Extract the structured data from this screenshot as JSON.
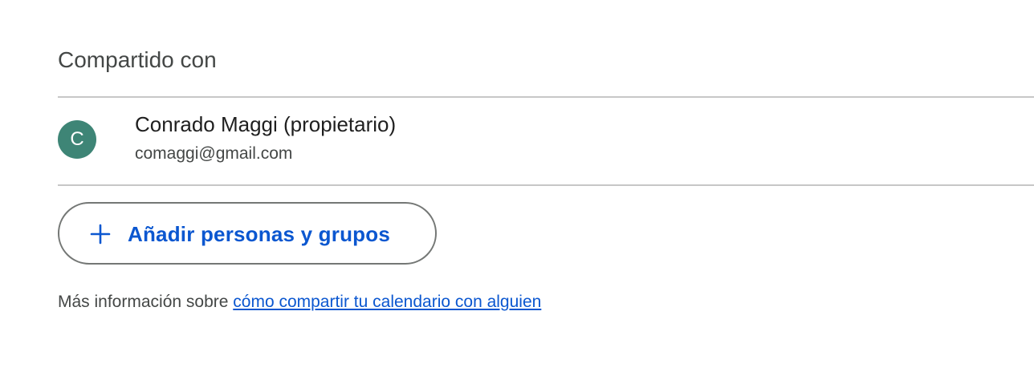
{
  "section": {
    "title": "Compartido con"
  },
  "members": [
    {
      "initial": "C",
      "name": "Conrado Maggi (propietario)",
      "email": "comaggi@gmail.com",
      "avatar_color": "#3e8576"
    }
  ],
  "add_button": {
    "icon": "plus-icon",
    "label": "Añadir personas y grupos"
  },
  "info": {
    "prefix": "Más información sobre",
    "link_text": "cómo compartir tu calendario con alguien"
  },
  "colors": {
    "accent": "#0b57d0",
    "divider": "#c7c7c7",
    "text_secondary": "#444746"
  }
}
